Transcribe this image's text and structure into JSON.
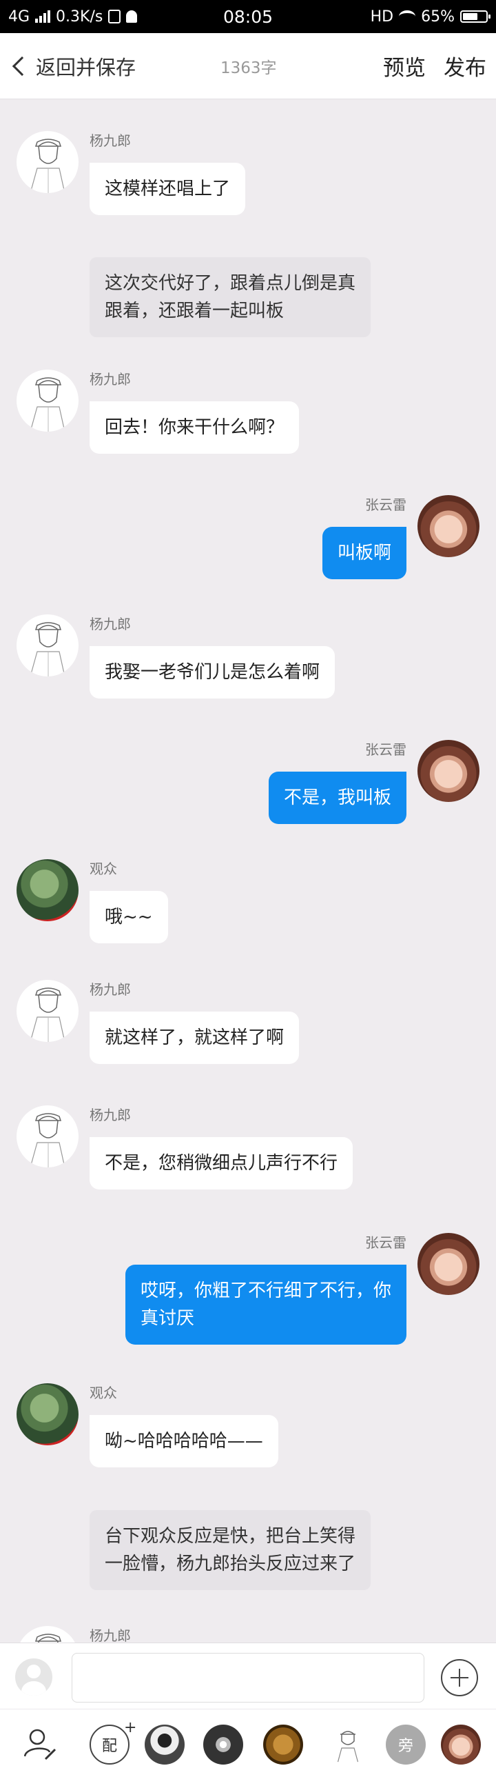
{
  "status_bar": {
    "network": "4G",
    "speed": "0.3K/s",
    "time": "08:05",
    "hd": "HD",
    "battery": "65%",
    "battery_level": 0.65
  },
  "header": {
    "back_label": "返回并保存",
    "word_count": "1363字",
    "preview_label": "预览",
    "publish_label": "发布"
  },
  "messages": [
    {
      "type": "left",
      "speaker": "杨九郎",
      "avatar": "sketch-boy",
      "lines": [
        "这模样还唱上了"
      ]
    },
    {
      "type": "narration",
      "lines": [
        "这次交代好了，跟着点儿倒是真",
        "跟着，还跟着一起叫板"
      ]
    },
    {
      "type": "left",
      "speaker": "杨九郎",
      "avatar": "sketch-boy",
      "lines": [
        "回去！你来干什么啊？"
      ]
    },
    {
      "type": "right",
      "speaker": "张云雷",
      "avatar": "photo-young-man",
      "lines": [
        "叫板啊"
      ]
    },
    {
      "type": "left",
      "speaker": "杨九郎",
      "avatar": "sketch-boy",
      "lines": [
        "我娶一老爷们儿是怎么着啊"
      ]
    },
    {
      "type": "right",
      "speaker": "张云雷",
      "avatar": "photo-young-man",
      "lines": [
        "不是，我叫板"
      ]
    },
    {
      "type": "left",
      "speaker": "观众",
      "avatar": "green-bird",
      "lines": [
        "哦~~"
      ]
    },
    {
      "type": "left",
      "speaker": "杨九郎",
      "avatar": "sketch-boy",
      "lines": [
        "就这样了，就这样了啊"
      ]
    },
    {
      "type": "left",
      "speaker": "杨九郎",
      "avatar": "sketch-boy",
      "lines": [
        "不是，您稍微细点儿声行不行"
      ]
    },
    {
      "type": "right",
      "speaker": "张云雷",
      "avatar": "photo-young-man",
      "lines": [
        "哎呀，你粗了不行细了不行，你",
        "真讨厌"
      ]
    },
    {
      "type": "left",
      "speaker": "观众",
      "avatar": "green-bird",
      "lines": [
        "呦~哈哈哈哈哈——"
      ]
    },
    {
      "type": "narration",
      "lines": [
        "台下观众反应是快，把台上笑得",
        "一脸懵，杨九郎抬头反应过来了"
      ]
    },
    {
      "type": "left",
      "speaker": "杨九郎",
      "avatar": "sketch-boy",
      "lines": [
        ""
      ]
    }
  ],
  "input_bar": {
    "placeholder": "",
    "value": ""
  },
  "role_bar": {
    "items": [
      {
        "name": "edit-role",
        "icon": "user-edit-icon"
      },
      {
        "name": "narration-role",
        "label": "配",
        "icon": "plus-icon"
      },
      {
        "name": "role-1",
        "icon": "avatar"
      },
      {
        "name": "role-2",
        "icon": "avatar"
      },
      {
        "name": "role-3",
        "icon": "avatar"
      },
      {
        "name": "role-yang",
        "icon": "sketch-boy"
      },
      {
        "name": "aside-role",
        "label": "旁"
      },
      {
        "name": "role-zhang",
        "icon": "photo-young-man"
      }
    ]
  },
  "colors": {
    "accent_bubble": "#108cf0",
    "background": "#efecef",
    "narration_bubble": "#e6e3e7"
  }
}
